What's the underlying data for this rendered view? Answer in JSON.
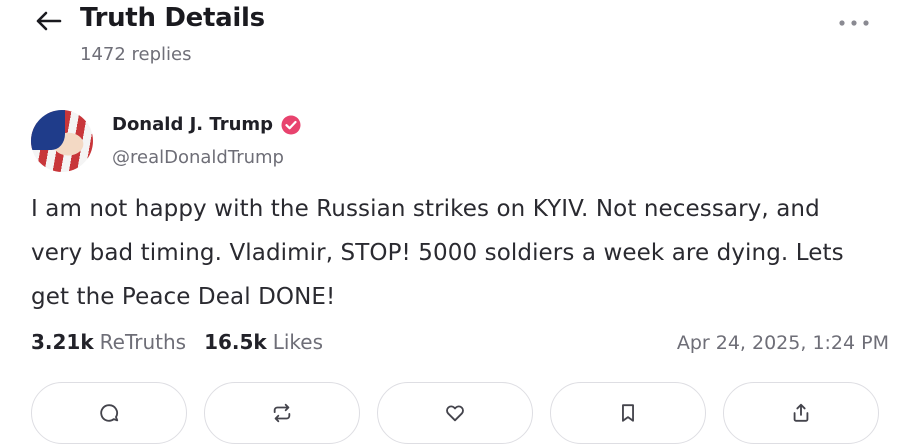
{
  "header": {
    "back_icon": "arrow-left-icon",
    "title": "Truth Details",
    "subtitle": "1472 replies",
    "more_icon": "more-horizontal-icon"
  },
  "post": {
    "author": {
      "name": "Donald J. Trump",
      "handle": "@realDonaldTrump",
      "verified": true,
      "verified_color": "#e8436e"
    },
    "text": "I am not happy with the Russian strikes on KYIV. Not necessary, and very bad timing. Vladimir, STOP! 5000 soldiers a week are dying. Lets get the Peace Deal DONE!",
    "stats": {
      "retruths_count": "3.21k",
      "retruths_label": "ReTruths",
      "likes_count": "16.5k",
      "likes_label": "Likes"
    },
    "timestamp": "Apr 24, 2025, 1:24 PM"
  },
  "actions": [
    {
      "name": "reply",
      "icon": "reply-icon"
    },
    {
      "name": "retruth",
      "icon": "retruth-icon"
    },
    {
      "name": "like",
      "icon": "heart-icon"
    },
    {
      "name": "bookmark",
      "icon": "bookmark-icon"
    },
    {
      "name": "share",
      "icon": "share-icon"
    }
  ]
}
